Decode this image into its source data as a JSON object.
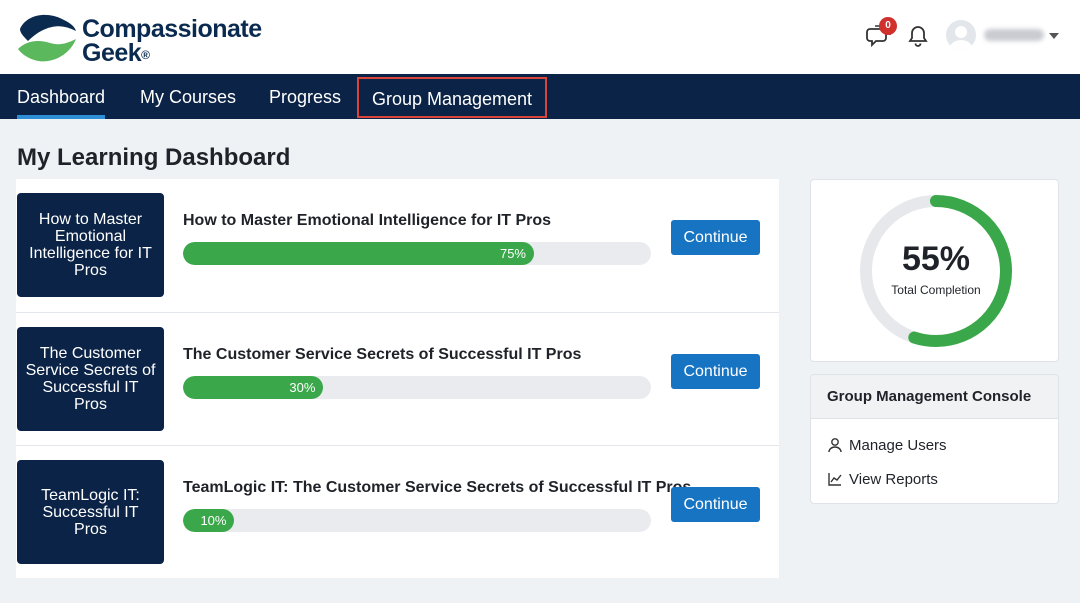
{
  "brand": {
    "name_line1": "Compassionate",
    "name_line2": "Geek",
    "trademark": "®"
  },
  "header": {
    "chat_badge": "0",
    "user_name": "Greenday"
  },
  "nav": [
    {
      "label": "Dashboard"
    },
    {
      "label": "My Courses"
    },
    {
      "label": "Progress"
    },
    {
      "label": "Group Management"
    }
  ],
  "page": {
    "title": "My Learning Dashboard"
  },
  "courses": [
    {
      "thumb": "How to Master Emotional Intelligence for IT Pros",
      "title": "How to Master Emotional Intelligence for IT Pros",
      "progress": 75,
      "progress_label": "75%",
      "button": "Continue"
    },
    {
      "thumb": "The Customer Service Secrets of Successful IT Pros",
      "title": "The Customer Service Secrets of Successful IT Pros",
      "progress": 30,
      "progress_label": "30%",
      "button": "Continue"
    },
    {
      "thumb": "TeamLogic IT: Successful IT Pros",
      "title": "TeamLogic IT: The Customer Service Secrets of Successful IT Pros",
      "progress": 10,
      "progress_label": "10%",
      "button": "Continue"
    }
  ],
  "completion": {
    "value": 55,
    "label_pct": "55%",
    "label": "Total Completion"
  },
  "console": {
    "title": "Group Management Console",
    "links": [
      {
        "label": "Manage Users",
        "icon": "user-icon"
      },
      {
        "label": "View Reports",
        "icon": "chart-line-icon"
      }
    ]
  },
  "colors": {
    "navy": "#0b2346",
    "accent_blue": "#1774c3",
    "progress_green": "#3aa84a",
    "highlight_red": "#d8453b"
  }
}
